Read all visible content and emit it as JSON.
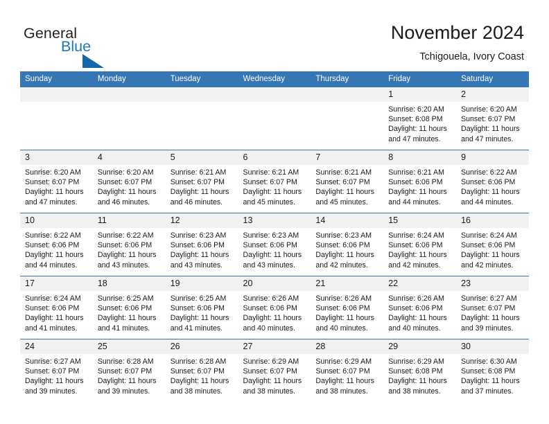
{
  "brand": {
    "word_one": "General",
    "word_two": "Blue",
    "logo_icon": "triangle-logo-icon"
  },
  "header": {
    "title": "November 2024",
    "subtitle": "Tchigouela, Ivory Coast"
  },
  "colors": {
    "header_blue": "#3576b5",
    "brand_blue": "#1679c4",
    "daynum_band": "#f1f1f1",
    "text": "#1a1a1a"
  },
  "calendar": {
    "weekday_headers": [
      "Sunday",
      "Monday",
      "Tuesday",
      "Wednesday",
      "Thursday",
      "Friday",
      "Saturday"
    ],
    "weeks": [
      [
        {
          "day": "",
          "sunrise": "",
          "sunset": "",
          "daylight": ""
        },
        {
          "day": "",
          "sunrise": "",
          "sunset": "",
          "daylight": ""
        },
        {
          "day": "",
          "sunrise": "",
          "sunset": "",
          "daylight": ""
        },
        {
          "day": "",
          "sunrise": "",
          "sunset": "",
          "daylight": ""
        },
        {
          "day": "",
          "sunrise": "",
          "sunset": "",
          "daylight": ""
        },
        {
          "day": "1",
          "sunrise": "Sunrise: 6:20 AM",
          "sunset": "Sunset: 6:08 PM",
          "daylight": "Daylight: 11 hours and 47 minutes."
        },
        {
          "day": "2",
          "sunrise": "Sunrise: 6:20 AM",
          "sunset": "Sunset: 6:07 PM",
          "daylight": "Daylight: 11 hours and 47 minutes."
        }
      ],
      [
        {
          "day": "3",
          "sunrise": "Sunrise: 6:20 AM",
          "sunset": "Sunset: 6:07 PM",
          "daylight": "Daylight: 11 hours and 47 minutes."
        },
        {
          "day": "4",
          "sunrise": "Sunrise: 6:20 AM",
          "sunset": "Sunset: 6:07 PM",
          "daylight": "Daylight: 11 hours and 46 minutes."
        },
        {
          "day": "5",
          "sunrise": "Sunrise: 6:21 AM",
          "sunset": "Sunset: 6:07 PM",
          "daylight": "Daylight: 11 hours and 46 minutes."
        },
        {
          "day": "6",
          "sunrise": "Sunrise: 6:21 AM",
          "sunset": "Sunset: 6:07 PM",
          "daylight": "Daylight: 11 hours and 45 minutes."
        },
        {
          "day": "7",
          "sunrise": "Sunrise: 6:21 AM",
          "sunset": "Sunset: 6:07 PM",
          "daylight": "Daylight: 11 hours and 45 minutes."
        },
        {
          "day": "8",
          "sunrise": "Sunrise: 6:21 AM",
          "sunset": "Sunset: 6:06 PM",
          "daylight": "Daylight: 11 hours and 44 minutes."
        },
        {
          "day": "9",
          "sunrise": "Sunrise: 6:22 AM",
          "sunset": "Sunset: 6:06 PM",
          "daylight": "Daylight: 11 hours and 44 minutes."
        }
      ],
      [
        {
          "day": "10",
          "sunrise": "Sunrise: 6:22 AM",
          "sunset": "Sunset: 6:06 PM",
          "daylight": "Daylight: 11 hours and 44 minutes."
        },
        {
          "day": "11",
          "sunrise": "Sunrise: 6:22 AM",
          "sunset": "Sunset: 6:06 PM",
          "daylight": "Daylight: 11 hours and 43 minutes."
        },
        {
          "day": "12",
          "sunrise": "Sunrise: 6:23 AM",
          "sunset": "Sunset: 6:06 PM",
          "daylight": "Daylight: 11 hours and 43 minutes."
        },
        {
          "day": "13",
          "sunrise": "Sunrise: 6:23 AM",
          "sunset": "Sunset: 6:06 PM",
          "daylight": "Daylight: 11 hours and 43 minutes."
        },
        {
          "day": "14",
          "sunrise": "Sunrise: 6:23 AM",
          "sunset": "Sunset: 6:06 PM",
          "daylight": "Daylight: 11 hours and 42 minutes."
        },
        {
          "day": "15",
          "sunrise": "Sunrise: 6:24 AM",
          "sunset": "Sunset: 6:06 PM",
          "daylight": "Daylight: 11 hours and 42 minutes."
        },
        {
          "day": "16",
          "sunrise": "Sunrise: 6:24 AM",
          "sunset": "Sunset: 6:06 PM",
          "daylight": "Daylight: 11 hours and 42 minutes."
        }
      ],
      [
        {
          "day": "17",
          "sunrise": "Sunrise: 6:24 AM",
          "sunset": "Sunset: 6:06 PM",
          "daylight": "Daylight: 11 hours and 41 minutes."
        },
        {
          "day": "18",
          "sunrise": "Sunrise: 6:25 AM",
          "sunset": "Sunset: 6:06 PM",
          "daylight": "Daylight: 11 hours and 41 minutes."
        },
        {
          "day": "19",
          "sunrise": "Sunrise: 6:25 AM",
          "sunset": "Sunset: 6:06 PM",
          "daylight": "Daylight: 11 hours and 41 minutes."
        },
        {
          "day": "20",
          "sunrise": "Sunrise: 6:26 AM",
          "sunset": "Sunset: 6:06 PM",
          "daylight": "Daylight: 11 hours and 40 minutes."
        },
        {
          "day": "21",
          "sunrise": "Sunrise: 6:26 AM",
          "sunset": "Sunset: 6:06 PM",
          "daylight": "Daylight: 11 hours and 40 minutes."
        },
        {
          "day": "22",
          "sunrise": "Sunrise: 6:26 AM",
          "sunset": "Sunset: 6:06 PM",
          "daylight": "Daylight: 11 hours and 40 minutes."
        },
        {
          "day": "23",
          "sunrise": "Sunrise: 6:27 AM",
          "sunset": "Sunset: 6:07 PM",
          "daylight": "Daylight: 11 hours and 39 minutes."
        }
      ],
      [
        {
          "day": "24",
          "sunrise": "Sunrise: 6:27 AM",
          "sunset": "Sunset: 6:07 PM",
          "daylight": "Daylight: 11 hours and 39 minutes."
        },
        {
          "day": "25",
          "sunrise": "Sunrise: 6:28 AM",
          "sunset": "Sunset: 6:07 PM",
          "daylight": "Daylight: 11 hours and 39 minutes."
        },
        {
          "day": "26",
          "sunrise": "Sunrise: 6:28 AM",
          "sunset": "Sunset: 6:07 PM",
          "daylight": "Daylight: 11 hours and 38 minutes."
        },
        {
          "day": "27",
          "sunrise": "Sunrise: 6:29 AM",
          "sunset": "Sunset: 6:07 PM",
          "daylight": "Daylight: 11 hours and 38 minutes."
        },
        {
          "day": "28",
          "sunrise": "Sunrise: 6:29 AM",
          "sunset": "Sunset: 6:07 PM",
          "daylight": "Daylight: 11 hours and 38 minutes."
        },
        {
          "day": "29",
          "sunrise": "Sunrise: 6:29 AM",
          "sunset": "Sunset: 6:08 PM",
          "daylight": "Daylight: 11 hours and 38 minutes."
        },
        {
          "day": "30",
          "sunrise": "Sunrise: 6:30 AM",
          "sunset": "Sunset: 6:08 PM",
          "daylight": "Daylight: 11 hours and 37 minutes."
        }
      ]
    ]
  }
}
